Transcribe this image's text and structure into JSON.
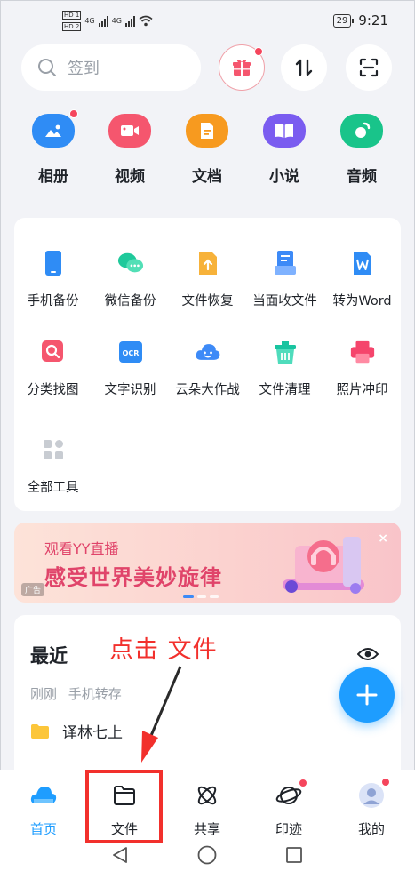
{
  "status_bar": {
    "sim1": "HD 1",
    "sim2": "HD 2",
    "net1": "4G",
    "net2": "4G",
    "battery": "29",
    "time": "9:21"
  },
  "search": {
    "placeholder": "签到"
  },
  "top_actions": [
    "gift-icon",
    "sort-icon",
    "scan-icon"
  ],
  "categories": [
    {
      "label": "相册",
      "icon": "album-icon",
      "color": "#2f8cf5"
    },
    {
      "label": "视频",
      "icon": "video-icon",
      "color": "#f5566e"
    },
    {
      "label": "文档",
      "icon": "document-icon",
      "color": "#f79a1f"
    },
    {
      "label": "小说",
      "icon": "novel-icon",
      "color": "#7a5cf0"
    },
    {
      "label": "音频",
      "icon": "audio-icon",
      "color": "#19c48a"
    }
  ],
  "tools": [
    {
      "label": "手机备份",
      "icon": "phone-backup-icon",
      "color": "#2f8cf5"
    },
    {
      "label": "微信备份",
      "icon": "wechat-backup-icon",
      "color": "#1fc99b"
    },
    {
      "label": "文件恢复",
      "icon": "file-restore-icon",
      "color": "#f7b23a"
    },
    {
      "label": "当面收文件",
      "icon": "receive-file-icon",
      "color": "#3d8af7"
    },
    {
      "label": "转为Word",
      "icon": "word-icon",
      "color": "#2f8cf5"
    },
    {
      "label": "分类找图",
      "icon": "image-search-icon",
      "color": "#f5566e"
    },
    {
      "label": "文字识别",
      "icon": "ocr-icon",
      "color": "#2f8cf5"
    },
    {
      "label": "云朵大作战",
      "icon": "cloud-game-icon",
      "color": "#3d8af7"
    },
    {
      "label": "文件清理",
      "icon": "file-clean-icon",
      "color": "#19c4a0"
    },
    {
      "label": "照片冲印",
      "icon": "photo-print-icon",
      "color": "#f5456c"
    },
    {
      "label": "全部工具",
      "icon": "all-tools-icon",
      "color": "#c8ccd2"
    }
  ],
  "banner": {
    "subtitle": "观看YY直播",
    "title": "感受世界美妙旋律",
    "ad_label": "广告",
    "close": "×"
  },
  "recent": {
    "title": "最近",
    "time": "刚刚",
    "source": "手机转存",
    "item": "译林七上"
  },
  "annotation": "点击 文件",
  "nav": [
    {
      "label": "首页",
      "icon": "home-cloud-icon",
      "active": true
    },
    {
      "label": "文件",
      "icon": "folder-icon",
      "active": false
    },
    {
      "label": "共享",
      "icon": "share-atom-icon",
      "active": false
    },
    {
      "label": "印迹",
      "icon": "planet-icon",
      "active": false
    },
    {
      "label": "我的",
      "icon": "avatar-icon",
      "active": false
    }
  ]
}
